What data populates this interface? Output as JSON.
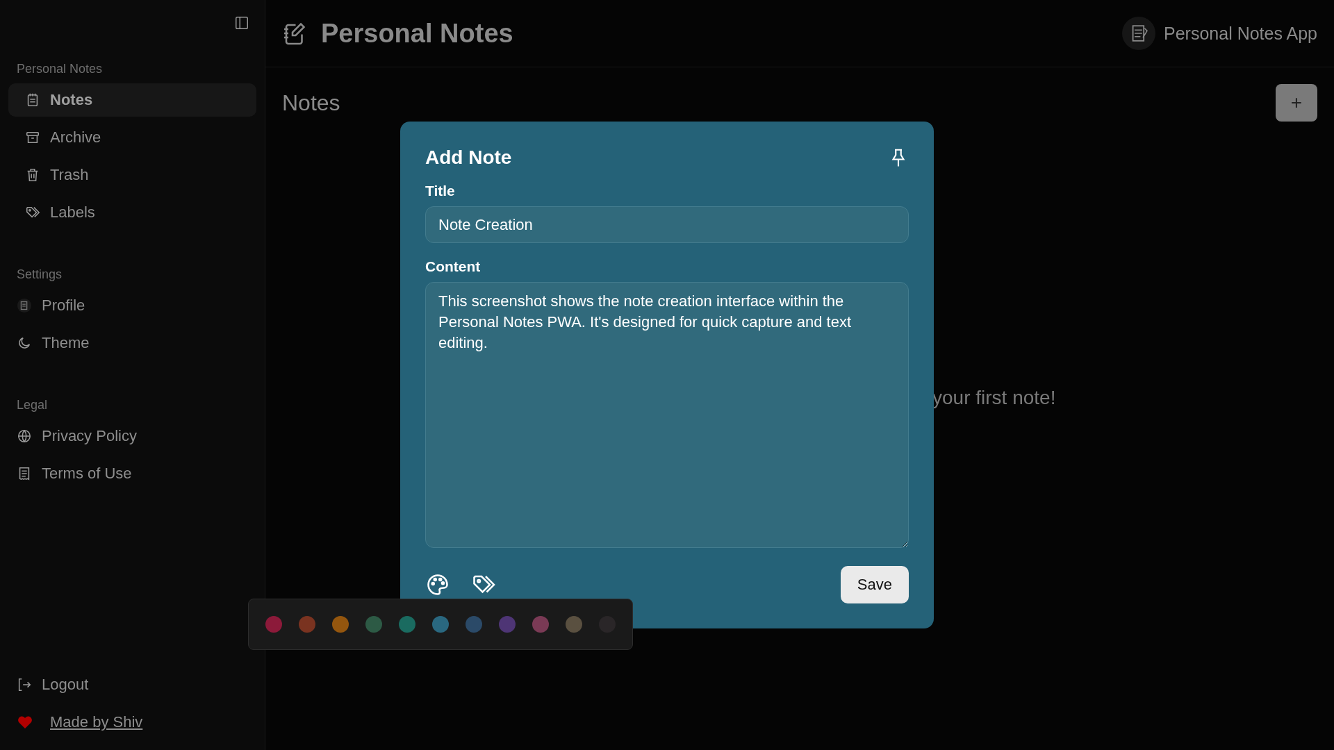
{
  "sidebar": {
    "sections": [
      {
        "heading": "Personal Notes",
        "items": [
          {
            "label": "Notes",
            "kind": "notepad",
            "selected": true
          },
          {
            "label": "Archive",
            "kind": "archive",
            "selected": false
          },
          {
            "label": "Trash",
            "kind": "trash",
            "selected": false
          },
          {
            "label": "Labels",
            "kind": "tags",
            "selected": false
          }
        ]
      },
      {
        "heading": "Settings",
        "items": [
          {
            "label": "Profile",
            "kind": "avatar",
            "selected": false
          },
          {
            "label": "Theme",
            "kind": "moon",
            "selected": false
          }
        ]
      },
      {
        "heading": "Legal",
        "items": [
          {
            "label": "Privacy Policy",
            "kind": "globe",
            "selected": false
          },
          {
            "label": "Terms of Use",
            "kind": "doc",
            "selected": false
          }
        ]
      }
    ],
    "logout": "Logout",
    "credit": "Made by Shiv"
  },
  "header": {
    "title": "Personal Notes",
    "app_name": "Personal Notes App"
  },
  "page": {
    "heading": "Notes",
    "add_button": "+",
    "empty_text": "your first note!"
  },
  "dialog": {
    "title": "Add Note",
    "title_label": "Title",
    "title_value": "Note Creation",
    "content_label": "Content",
    "content_value": "This screenshot shows the note creation interface within the Personal Notes PWA. It's designed for quick capture and text editing.",
    "save": "Save"
  },
  "palette": [
    {
      "color": "#8c1a3a"
    },
    {
      "color": "#7a3320"
    },
    {
      "color": "#94560e"
    },
    {
      "color": "#2d5a45"
    },
    {
      "color": "#1a6b60"
    },
    {
      "color": "#2a6880"
    },
    {
      "color": "#2b4a68"
    },
    {
      "color": "#4e3575"
    },
    {
      "color": "#7a3a55"
    },
    {
      "color": "#5a5040"
    },
    {
      "color": "#2a2628"
    }
  ]
}
